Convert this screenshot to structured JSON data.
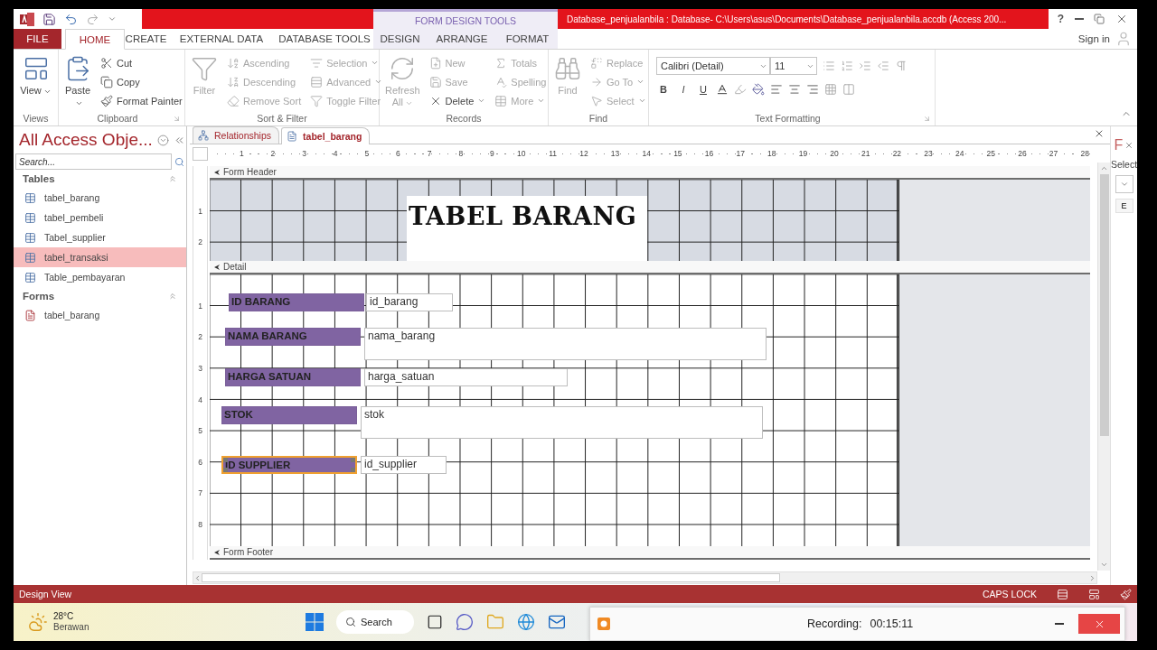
{
  "title_bar": {
    "title": "Database_penjualanbila : Database- C:\\Users\\asus\\Documents\\Database_penjualanbila.accdb (Access 200...",
    "context": "FORM DESIGN TOOLS",
    "help": "?"
  },
  "ribbon_tabs": [
    {
      "label": "FILE",
      "kind": "file",
      "selected": false
    },
    {
      "label": "HOME",
      "kind": "main",
      "selected": true
    },
    {
      "label": "CREATE",
      "kind": "main",
      "selected": false
    },
    {
      "label": "EXTERNAL DATA",
      "kind": "main",
      "selected": false
    },
    {
      "label": "DATABASE TOOLS",
      "kind": "main",
      "selected": false
    },
    {
      "label": "DESIGN",
      "kind": "context",
      "selected": false
    },
    {
      "label": "ARRANGE",
      "kind": "context",
      "selected": false
    },
    {
      "label": "FORMAT",
      "kind": "context",
      "selected": false
    }
  ],
  "sign_in": "Sign in",
  "ribbon_groups": [
    {
      "label": "Views",
      "kind": "buttons",
      "items": [
        {
          "label": "View",
          "kind": "large",
          "disabled": false,
          "menu": true
        }
      ]
    },
    {
      "label": "Clipboard",
      "kind": "buttons",
      "launcher": true,
      "items": [
        {
          "label": "Paste",
          "kind": "large",
          "disabled": false,
          "menu": true
        },
        {
          "label": "Cut",
          "kind": "small",
          "disabled": false
        },
        {
          "label": "Copy",
          "kind": "small",
          "disabled": false
        },
        {
          "label": "Format Painter",
          "kind": "small",
          "disabled": false
        }
      ]
    },
    {
      "label": "Sort & Filter",
      "kind": "buttons",
      "items": [
        {
          "label": "Filter",
          "kind": "large",
          "disabled": true
        },
        {
          "label": "Ascending",
          "kind": "small",
          "disabled": true
        },
        {
          "label": "Descending",
          "kind": "small",
          "disabled": true
        },
        {
          "label": "Remove Sort",
          "kind": "small",
          "disabled": true
        },
        {
          "label": "Selection",
          "kind": "small",
          "disabled": true,
          "menu": true
        },
        {
          "label": "Advanced",
          "kind": "small",
          "disabled": true,
          "menu": true
        },
        {
          "label": "Toggle Filter",
          "kind": "small",
          "disabled": true
        }
      ]
    },
    {
      "label": "Records",
      "kind": "buttons",
      "items": [
        {
          "label": "Refresh All",
          "kind": "large",
          "disabled": true,
          "menu": true
        },
        {
          "label": "New",
          "kind": "small",
          "disabled": true
        },
        {
          "label": "Save",
          "kind": "small",
          "disabled": true
        },
        {
          "label": "Delete",
          "kind": "small",
          "disabled": false,
          "menu": true
        },
        {
          "label": "Totals",
          "kind": "small",
          "disabled": true
        },
        {
          "label": "Spelling",
          "kind": "small",
          "disabled": true
        },
        {
          "label": "More",
          "kind": "small",
          "disabled": true,
          "menu": true
        }
      ]
    },
    {
      "label": "Find",
      "kind": "buttons",
      "items": [
        {
          "label": "Find",
          "kind": "large",
          "disabled": true
        },
        {
          "label": "Replace",
          "kind": "small",
          "disabled": true
        },
        {
          "label": "Go To",
          "kind": "small",
          "disabled": true,
          "menu": true
        },
        {
          "label": "Select",
          "kind": "small",
          "disabled": true,
          "menu": true
        }
      ]
    },
    {
      "label": "Text Formatting",
      "kind": "text_formatting",
      "launcher": true,
      "font": "Calibri (Detail)",
      "size": "11",
      "styles": [
        "B",
        "I",
        "U"
      ]
    }
  ],
  "nav": {
    "title": "All Access Obje...",
    "search_placeholder": "Search...",
    "groups": [
      {
        "label": "Tables",
        "kind": "table",
        "items": [
          {
            "label": "tabel_barang",
            "selected": false
          },
          {
            "label": "tabel_pembeli",
            "selected": false
          },
          {
            "label": "Tabel_supplier",
            "selected": false
          },
          {
            "label": "tabel_transaksi",
            "selected": true
          },
          {
            "label": "Table_pembayaran",
            "selected": false
          }
        ]
      },
      {
        "label": "Forms",
        "kind": "form",
        "items": [
          {
            "label": "tabel_barang",
            "selected": false
          }
        ]
      }
    ]
  },
  "documents": [
    {
      "label": "Relationships",
      "kind": "relationships",
      "selected": false
    },
    {
      "label": "tabel_barang",
      "kind": "form",
      "selected": true
    }
  ],
  "ruler": [
    "1",
    "2",
    "3",
    "4",
    "5",
    "6",
    "7",
    "8",
    "9",
    "10",
    "11",
    "12",
    "13",
    "14",
    "15",
    "16",
    "17",
    "18",
    "19",
    "20",
    "21",
    "22",
    "23",
    "24",
    "25",
    "26",
    "27",
    "28"
  ],
  "sections": [
    {
      "title": "Form Header",
      "kind": "header",
      "ruler": [
        "1",
        "2"
      ],
      "label": "TABEL BARANG"
    },
    {
      "title": "Detail",
      "kind": "detail",
      "ruler": [
        "1",
        "2",
        "3",
        "4",
        "5",
        "6",
        "7",
        "8"
      ],
      "controls": [
        {
          "label": "ID BARANG",
          "field": "id_barang",
          "selected": false
        },
        {
          "label": "NAMA BARANG",
          "field": "nama_barang",
          "selected": false
        },
        {
          "label": "HARGA SATUAN",
          "field": "harga_satuan",
          "selected": false
        },
        {
          "label": "STOK",
          "field": "stok",
          "selected": false
        },
        {
          "label": "ID SUPPLIER",
          "field": "id_supplier",
          "selected": true
        }
      ]
    },
    {
      "title": "Form Footer",
      "kind": "footer"
    }
  ],
  "property_sheet": {
    "title": "F",
    "label": "Select",
    "tab": "E"
  },
  "status_bar": {
    "mode": "Design View",
    "indicator": "CAPS LOCK"
  },
  "taskbar": {
    "temperature": "28°C",
    "weather": "Berawan",
    "search": "Search"
  },
  "recording": {
    "label": "Recording:",
    "time": "00:15:11"
  }
}
